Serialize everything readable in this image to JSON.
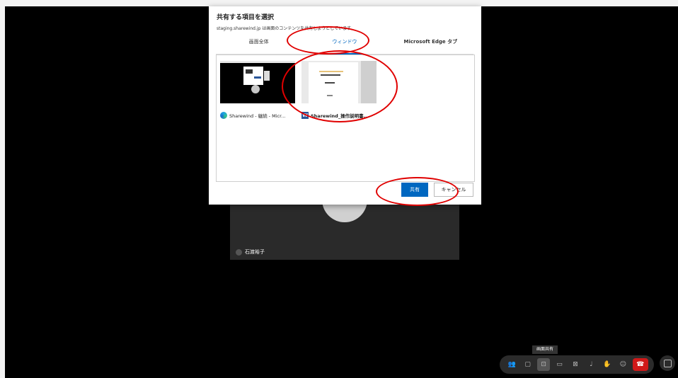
{
  "dialog": {
    "title": "共有する項目を選択",
    "subtitle": "staging.sharewind.jp は画面のコンテンツを共有しようとしています。",
    "tabs": [
      "画面全体",
      "ウィンドウ",
      "Microsoft Edge タブ"
    ],
    "active_tab_index": 1,
    "windows": [
      {
        "label": "Sharewind - 継続 - Micr...",
        "icon": "edge-icon"
      },
      {
        "label": "Sharewind_操作説明書...",
        "icon": "word-icon"
      }
    ],
    "share_label": "共有",
    "cancel_label": "キャンセル"
  },
  "meeting": {
    "participant_name": "石渡裕子",
    "tooltip": "画面共有"
  },
  "colors": {
    "accent": "#0067c0",
    "annotation": "#e00000",
    "hangup": "#d01919"
  }
}
